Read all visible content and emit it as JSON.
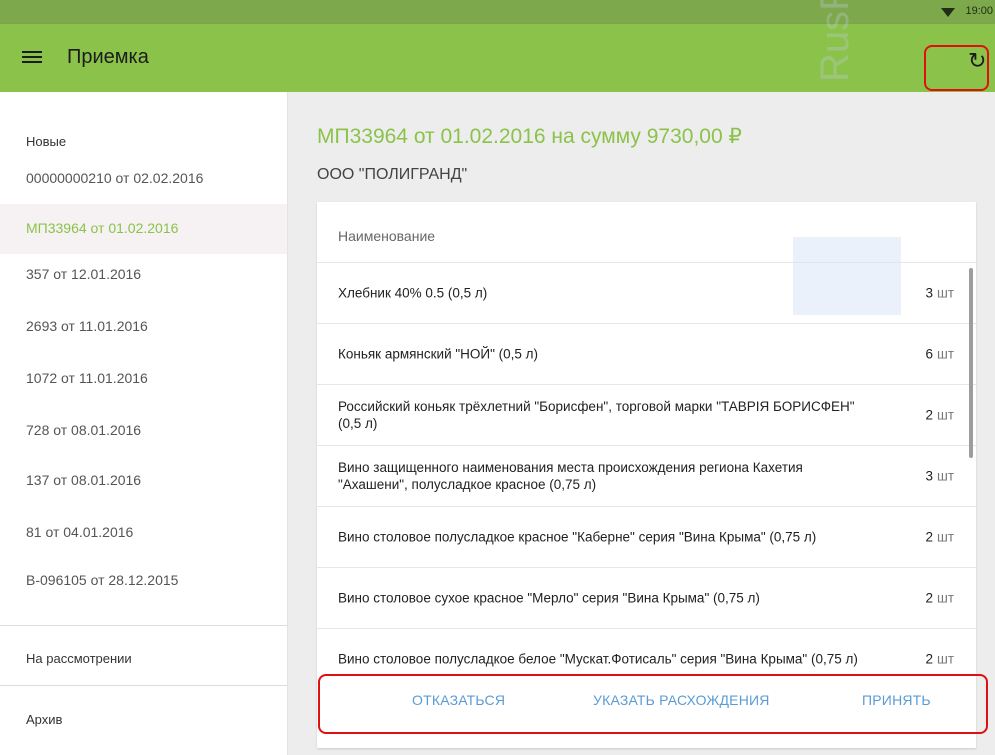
{
  "status_bar": {
    "time": "19:00"
  },
  "app_bar": {
    "title": "Приемка"
  },
  "sidebar": {
    "section_new": "Новые",
    "items": [
      {
        "label": "00000000210 от 02.02.2016",
        "selected": false
      },
      {
        "label": "МП33964 от 01.02.2016",
        "selected": true
      },
      {
        "label": "357 от 12.01.2016",
        "selected": false
      },
      {
        "label": "2693 от 11.01.2016",
        "selected": false
      },
      {
        "label": "1072 от 11.01.2016",
        "selected": false
      },
      {
        "label": "728 от 08.01.2016",
        "selected": false
      },
      {
        "label": "137 от 08.01.2016",
        "selected": false
      },
      {
        "label": "81 от 04.01.2016",
        "selected": false
      },
      {
        "label": "В-096105 от 28.12.2015",
        "selected": false
      }
    ],
    "section_review": "На рассмотрении",
    "section_archive": "Архив"
  },
  "document": {
    "title": "МП33964 от 01.02.2016 на сумму 9730,00 ₽",
    "supplier": "ООО \"ПОЛИГРАНД\"",
    "column_name": "Наименование",
    "items": [
      {
        "name": "Хлебник 40% 0.5  (0,5 л)",
        "qty": "3",
        "unit": "шт"
      },
      {
        "name": "Коньяк армянский \"НОЙ\"  (0,5 л)",
        "qty": "6",
        "unit": "шт"
      },
      {
        "name": "Российский коньяк трёхлетний \"Борисфен\", торговой марки \"ТАВРIЯ БОРИСФЕН\"  (0,5 л)",
        "qty": "2",
        "unit": "шт"
      },
      {
        "name": "Вино защищенного наименования места происхождения региона Кахетия \"Ахашени\", полусладкое красное  (0,75 л)",
        "qty": "3",
        "unit": "шт"
      },
      {
        "name": "Вино столовое полусладкое красное \"Каберне\" серия \"Вина Крыма\"  (0,75 л)",
        "qty": "2",
        "unit": "шт"
      },
      {
        "name": "Вино столовое сухое красное \"Мерло\" серия \"Вина Крыма\"  (0,75 л)",
        "qty": "2",
        "unit": "шт"
      },
      {
        "name": "Вино столовое полусладкое белое \"Мускат.Фотисаль\" серия \"Вина Крыма\"  (0,75 л)",
        "qty": "2",
        "unit": "шт"
      }
    ]
  },
  "actions": {
    "reject": "ОТКАЗАТЬСЯ",
    "discrepancy": "УКАЗАТЬ РАСХОЖДЕНИЯ",
    "accept": "ПРИНЯТЬ"
  },
  "watermark": "RusRetail.ru",
  "colors": {
    "app_bar": "#8bc34a",
    "status_bar": "#7da84b",
    "accent_title": "#8bc34a",
    "action_text": "#5b9bd5",
    "highlight_box": "#e01010"
  }
}
